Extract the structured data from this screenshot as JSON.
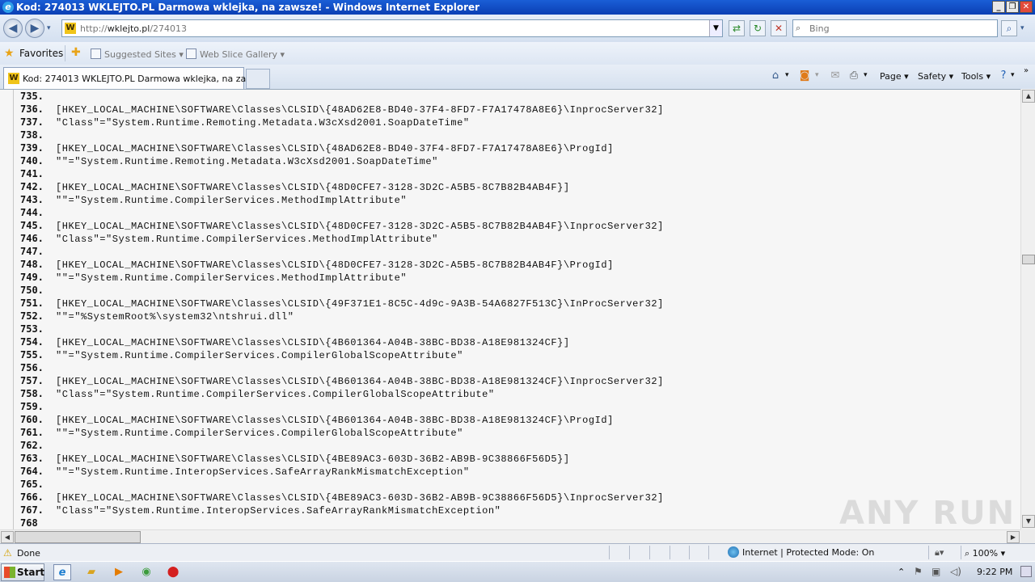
{
  "window": {
    "title": "Kod: 274013 WKLEJTO.PL Darmowa wklejka, na zawsze! - Windows Internet Explorer"
  },
  "address_bar": {
    "url_prefix": "http://",
    "url_host": "wklejto.pl",
    "url_path": "/274013"
  },
  "search": {
    "placeholder": "Bing"
  },
  "favorites_bar": {
    "favorites_label": "Favorites",
    "links": [
      {
        "label": "Suggested Sites ▾"
      },
      {
        "label": "Web Slice Gallery ▾"
      }
    ]
  },
  "tab": {
    "title": "Kod: 274013 WKLEJTO.PL Darmowa wklejka, na zaws..."
  },
  "command_bar": {
    "page_label": "Page ▾",
    "safety_label": "Safety ▾",
    "tools_label": "Tools ▾"
  },
  "code_lines": [
    {
      "num": "735.",
      "text": ""
    },
    {
      "num": "736.",
      "text": "[HKEY_LOCAL_MACHINE\\SOFTWARE\\Classes\\CLSID\\{48AD62E8-BD40-37F4-8FD7-F7A17478A8E6}\\InprocServer32]"
    },
    {
      "num": "737.",
      "text": "\"Class\"=\"System.Runtime.Remoting.Metadata.W3cXsd2001.SoapDateTime\""
    },
    {
      "num": "738.",
      "text": ""
    },
    {
      "num": "739.",
      "text": "[HKEY_LOCAL_MACHINE\\SOFTWARE\\Classes\\CLSID\\{48AD62E8-BD40-37F4-8FD7-F7A17478A8E6}\\ProgId]"
    },
    {
      "num": "740.",
      "text": "\"\"=\"System.Runtime.Remoting.Metadata.W3cXsd2001.SoapDateTime\""
    },
    {
      "num": "741.",
      "text": ""
    },
    {
      "num": "742.",
      "text": "[HKEY_LOCAL_MACHINE\\SOFTWARE\\Classes\\CLSID\\{48D0CFE7-3128-3D2C-A5B5-8C7B82B4AB4F}]"
    },
    {
      "num": "743.",
      "text": "\"\"=\"System.Runtime.CompilerServices.MethodImplAttribute\""
    },
    {
      "num": "744.",
      "text": ""
    },
    {
      "num": "745.",
      "text": "[HKEY_LOCAL_MACHINE\\SOFTWARE\\Classes\\CLSID\\{48D0CFE7-3128-3D2C-A5B5-8C7B82B4AB4F}\\InprocServer32]"
    },
    {
      "num": "746.",
      "text": "\"Class\"=\"System.Runtime.CompilerServices.MethodImplAttribute\""
    },
    {
      "num": "747.",
      "text": ""
    },
    {
      "num": "748.",
      "text": "[HKEY_LOCAL_MACHINE\\SOFTWARE\\Classes\\CLSID\\{48D0CFE7-3128-3D2C-A5B5-8C7B82B4AB4F}\\ProgId]"
    },
    {
      "num": "749.",
      "text": "\"\"=\"System.Runtime.CompilerServices.MethodImplAttribute\""
    },
    {
      "num": "750.",
      "text": ""
    },
    {
      "num": "751.",
      "text": "[HKEY_LOCAL_MACHINE\\SOFTWARE\\Classes\\CLSID\\{49F371E1-8C5C-4d9c-9A3B-54A6827F513C}\\InProcServer32]"
    },
    {
      "num": "752.",
      "text": "\"\"=\"%SystemRoot%\\system32\\ntshrui.dll\""
    },
    {
      "num": "753.",
      "text": ""
    },
    {
      "num": "754.",
      "text": "[HKEY_LOCAL_MACHINE\\SOFTWARE\\Classes\\CLSID\\{4B601364-A04B-38BC-BD38-A18E981324CF}]"
    },
    {
      "num": "755.",
      "text": "\"\"=\"System.Runtime.CompilerServices.CompilerGlobalScopeAttribute\""
    },
    {
      "num": "756.",
      "text": ""
    },
    {
      "num": "757.",
      "text": "[HKEY_LOCAL_MACHINE\\SOFTWARE\\Classes\\CLSID\\{4B601364-A04B-38BC-BD38-A18E981324CF}\\InprocServer32]"
    },
    {
      "num": "758.",
      "text": "\"Class\"=\"System.Runtime.CompilerServices.CompilerGlobalScopeAttribute\""
    },
    {
      "num": "759.",
      "text": ""
    },
    {
      "num": "760.",
      "text": "[HKEY_LOCAL_MACHINE\\SOFTWARE\\Classes\\CLSID\\{4B601364-A04B-38BC-BD38-A18E981324CF}\\ProgId]"
    },
    {
      "num": "761.",
      "text": "\"\"=\"System.Runtime.CompilerServices.CompilerGlobalScopeAttribute\""
    },
    {
      "num": "762.",
      "text": ""
    },
    {
      "num": "763.",
      "text": "[HKEY_LOCAL_MACHINE\\SOFTWARE\\Classes\\CLSID\\{4BE89AC3-603D-36B2-AB9B-9C38866F56D5}]"
    },
    {
      "num": "764.",
      "text": "\"\"=\"System.Runtime.InteropServices.SafeArrayRankMismatchException\""
    },
    {
      "num": "765.",
      "text": ""
    },
    {
      "num": "766.",
      "text": "[HKEY_LOCAL_MACHINE\\SOFTWARE\\Classes\\CLSID\\{4BE89AC3-603D-36B2-AB9B-9C38866F56D5}\\InprocServer32]"
    },
    {
      "num": "767.",
      "text": "\"Class\"=\"System.Runtime.InteropServices.SafeArrayRankMismatchException\""
    },
    {
      "num": "768",
      "text": ""
    }
  ],
  "watermark": "ANY RUN",
  "status_bar": {
    "status_text": "Done",
    "zone_text": "Internet | Protected Mode: On",
    "zoom_text": "100%"
  },
  "taskbar": {
    "start_label": "Start",
    "clock": "9:22 PM"
  },
  "colors": {
    "titlebar": "#0b3fb4",
    "content_bg": "#f6f6f6"
  }
}
